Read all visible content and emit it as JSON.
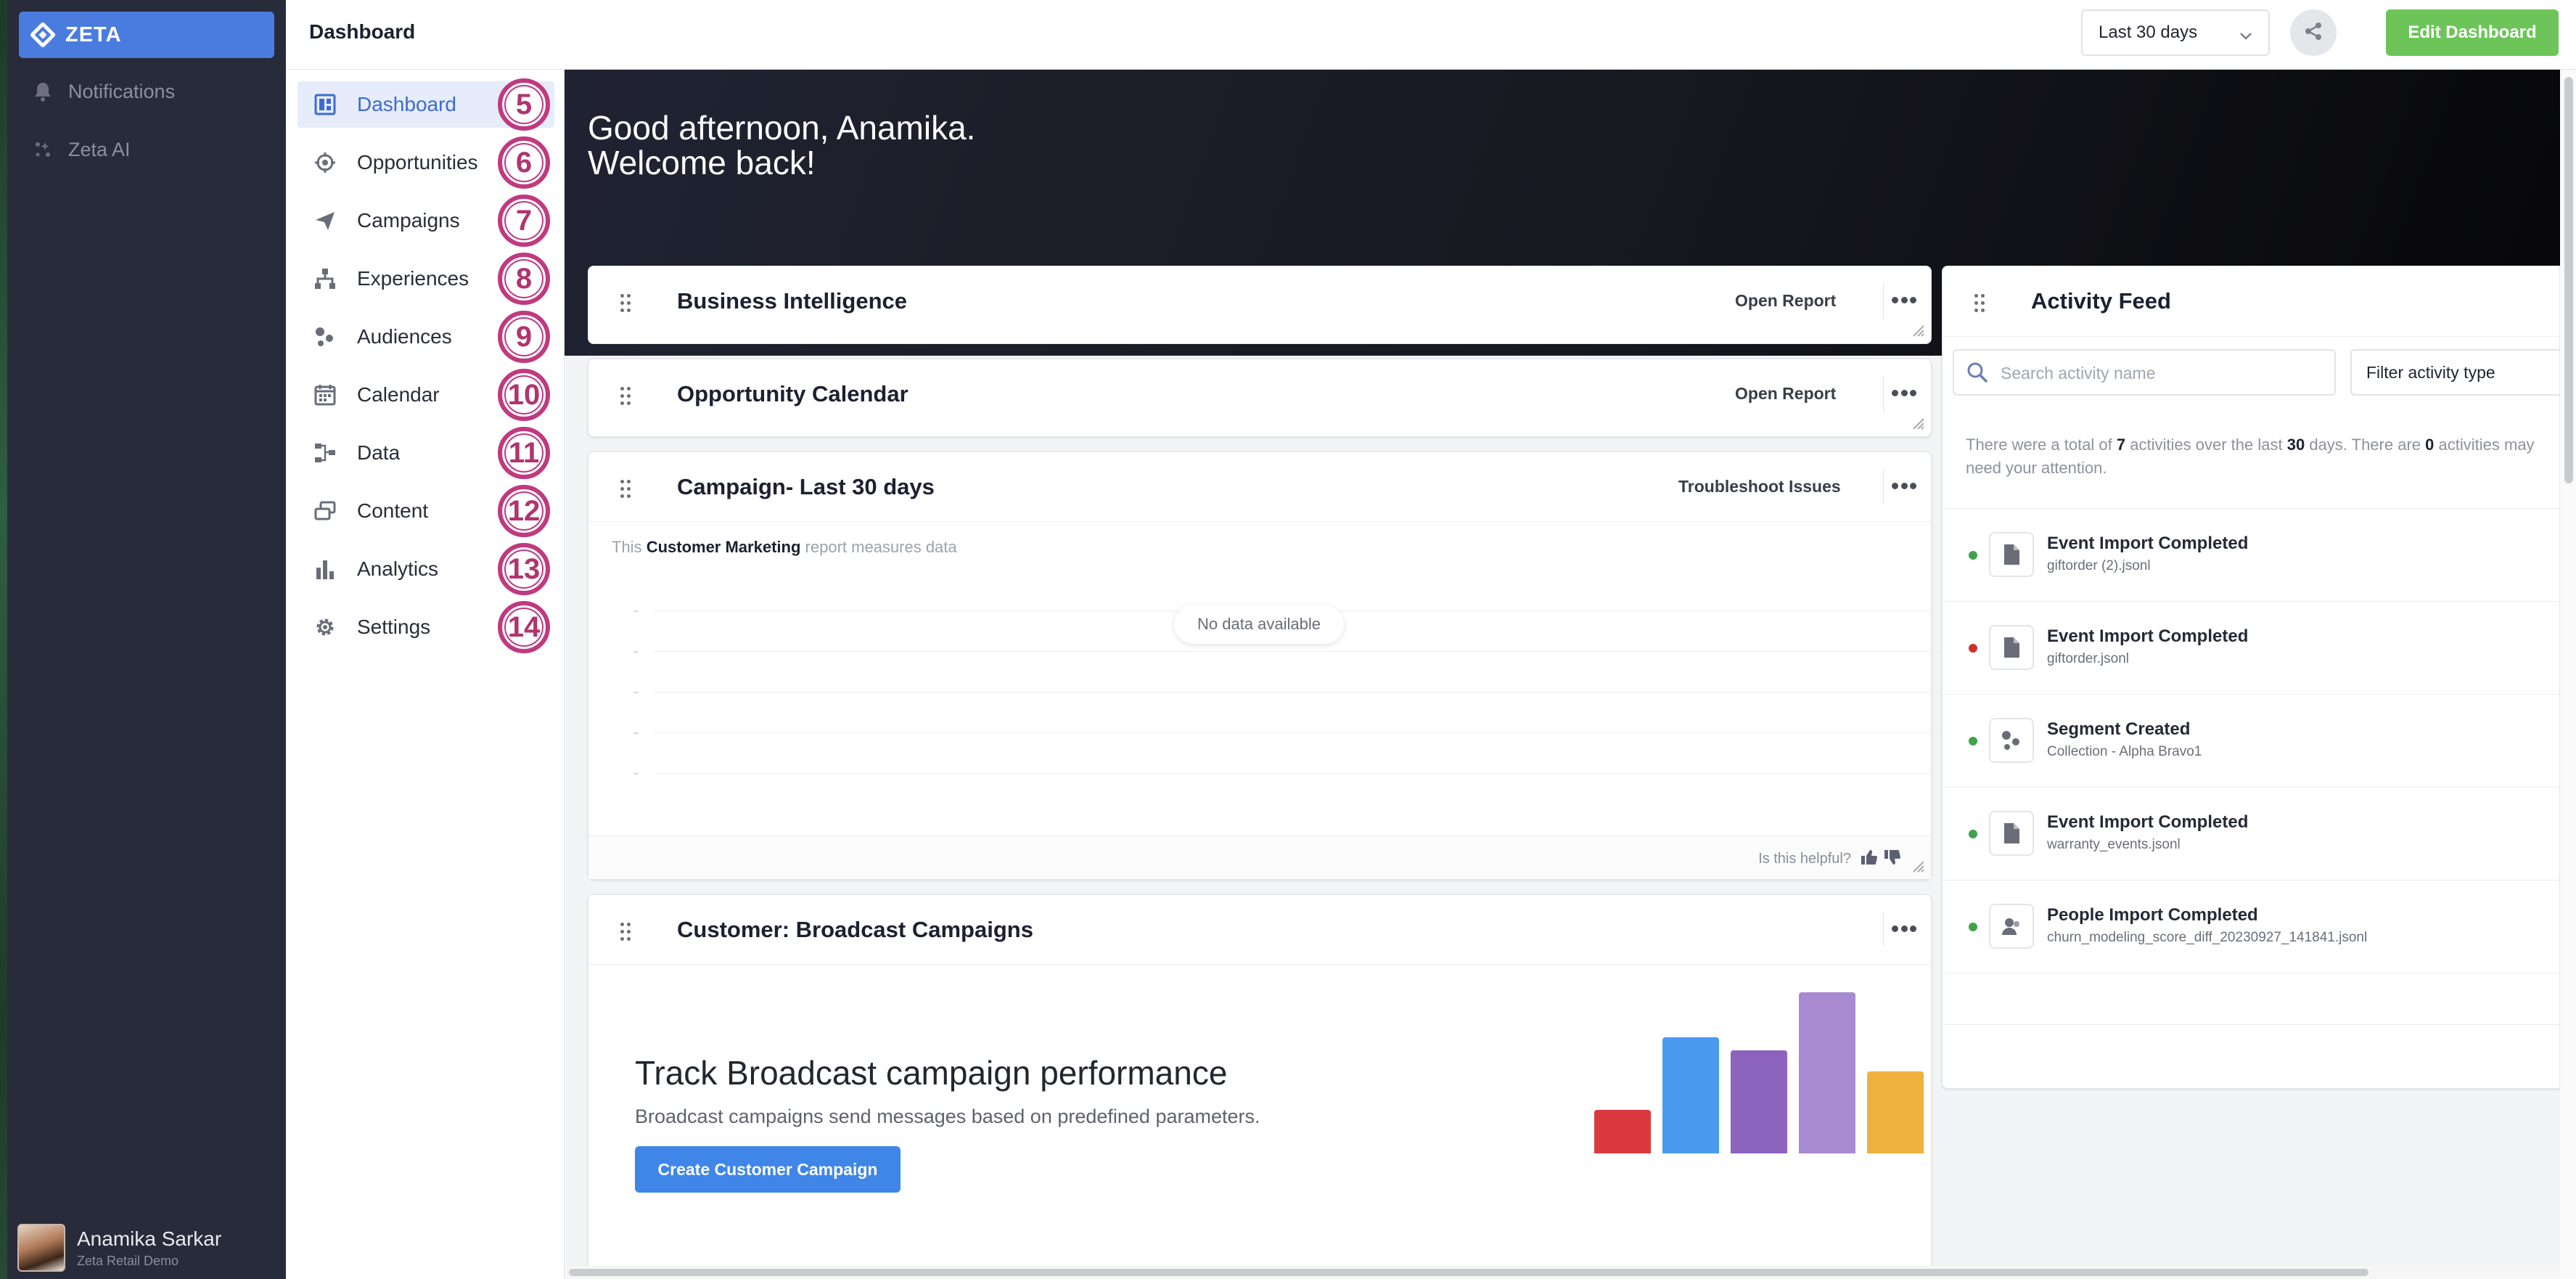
{
  "rail": {
    "brand": "ZETA",
    "items": [
      {
        "label": "Notifications",
        "icon": "bell-icon"
      },
      {
        "label": "Zeta AI",
        "icon": "sparkle-icon"
      }
    ],
    "user": {
      "name": "Anamika Sarkar",
      "org": "Zeta Retail Demo"
    }
  },
  "topbar": {
    "title": "Dashboard",
    "date_range": "Last 30 days",
    "edit_label": "Edit Dashboard"
  },
  "nav": {
    "items": [
      {
        "label": "Dashboard",
        "badge": "5",
        "icon": "dashboard-icon",
        "active": true
      },
      {
        "label": "Opportunities",
        "badge": "6",
        "icon": "target-icon"
      },
      {
        "label": "Campaigns",
        "badge": "7",
        "icon": "paper-plane-icon"
      },
      {
        "label": "Experiences",
        "badge": "8",
        "icon": "sitemap-icon"
      },
      {
        "label": "Audiences",
        "badge": "9",
        "icon": "audience-icon"
      },
      {
        "label": "Calendar",
        "badge": "10",
        "icon": "calendar-icon"
      },
      {
        "label": "Data",
        "badge": "11",
        "icon": "data-flow-icon"
      },
      {
        "label": "Content",
        "badge": "12",
        "icon": "content-stack-icon"
      },
      {
        "label": "Analytics",
        "badge": "13",
        "icon": "bar-chart-icon"
      },
      {
        "label": "Settings",
        "badge": "14",
        "icon": "gear-icon"
      }
    ]
  },
  "hero": {
    "line1": "Good afternoon, Anamika.",
    "line2": "Welcome back!"
  },
  "cards": {
    "bi": {
      "title": "Business Intelligence",
      "action": "Open Report"
    },
    "calendar": {
      "title": "Opportunity Calendar",
      "action": "Open Report"
    },
    "campaign": {
      "title": "Campaign- Last 30 days",
      "action": "Troubleshoot Issues",
      "desc_pre": "This",
      "desc_bold": "Customer Marketing",
      "desc_post": "report measures data",
      "no_data": "No data available",
      "helpful": "Is this helpful?"
    },
    "broadcast": {
      "title": "Customer: Broadcast Campaigns",
      "promo_title": "Track Broadcast campaign performance",
      "promo_desc": "Broadcast campaigns send messages based on predefined parameters.",
      "button": "Create Customer Campaign",
      "bar_levels": [
        0.27,
        0.72,
        0.64,
        1.0,
        0.51
      ],
      "bar_colors": [
        "#d9393f",
        "#4a9af0",
        "#8b63bf",
        "#a88ad1",
        "#f0b23f"
      ]
    }
  },
  "feed": {
    "title": "Activity Feed",
    "search_placeholder": "Search activity name",
    "filter_label": "Filter activity type",
    "summary": {
      "p1": "There were a total of",
      "total": "7",
      "p2": "activities over the last",
      "days": "30",
      "p3": "days. There are",
      "attention": "0",
      "p4": "activities may need your attention."
    },
    "items": [
      {
        "title": "Event Import Completed",
        "sub": "giftorder (2).jsonl",
        "status": "#3ea34a",
        "icon": "file-icon"
      },
      {
        "title": "Event Import Completed",
        "sub": "giftorder.jsonl",
        "status": "#d0312d",
        "icon": "file-icon"
      },
      {
        "title": "Segment Created",
        "sub": "Collection - Alpha Bravo1",
        "status": "#3ea34a",
        "icon": "segment-icon"
      },
      {
        "title": "Event Import Completed",
        "sub": "warranty_events.jsonl",
        "status": "#3ea34a",
        "icon": "file-icon"
      },
      {
        "title": "People Import Completed",
        "sub": "churn_modeling_score_diff_20230927_141841.jsonl",
        "status": "#3ea34a",
        "icon": "people-icon"
      }
    ]
  },
  "colors": {
    "brand": "#4a7ce0",
    "edit_button": "#6dc55a",
    "primary_button": "#3f86e8",
    "badge_ring": "#c03a7f"
  }
}
